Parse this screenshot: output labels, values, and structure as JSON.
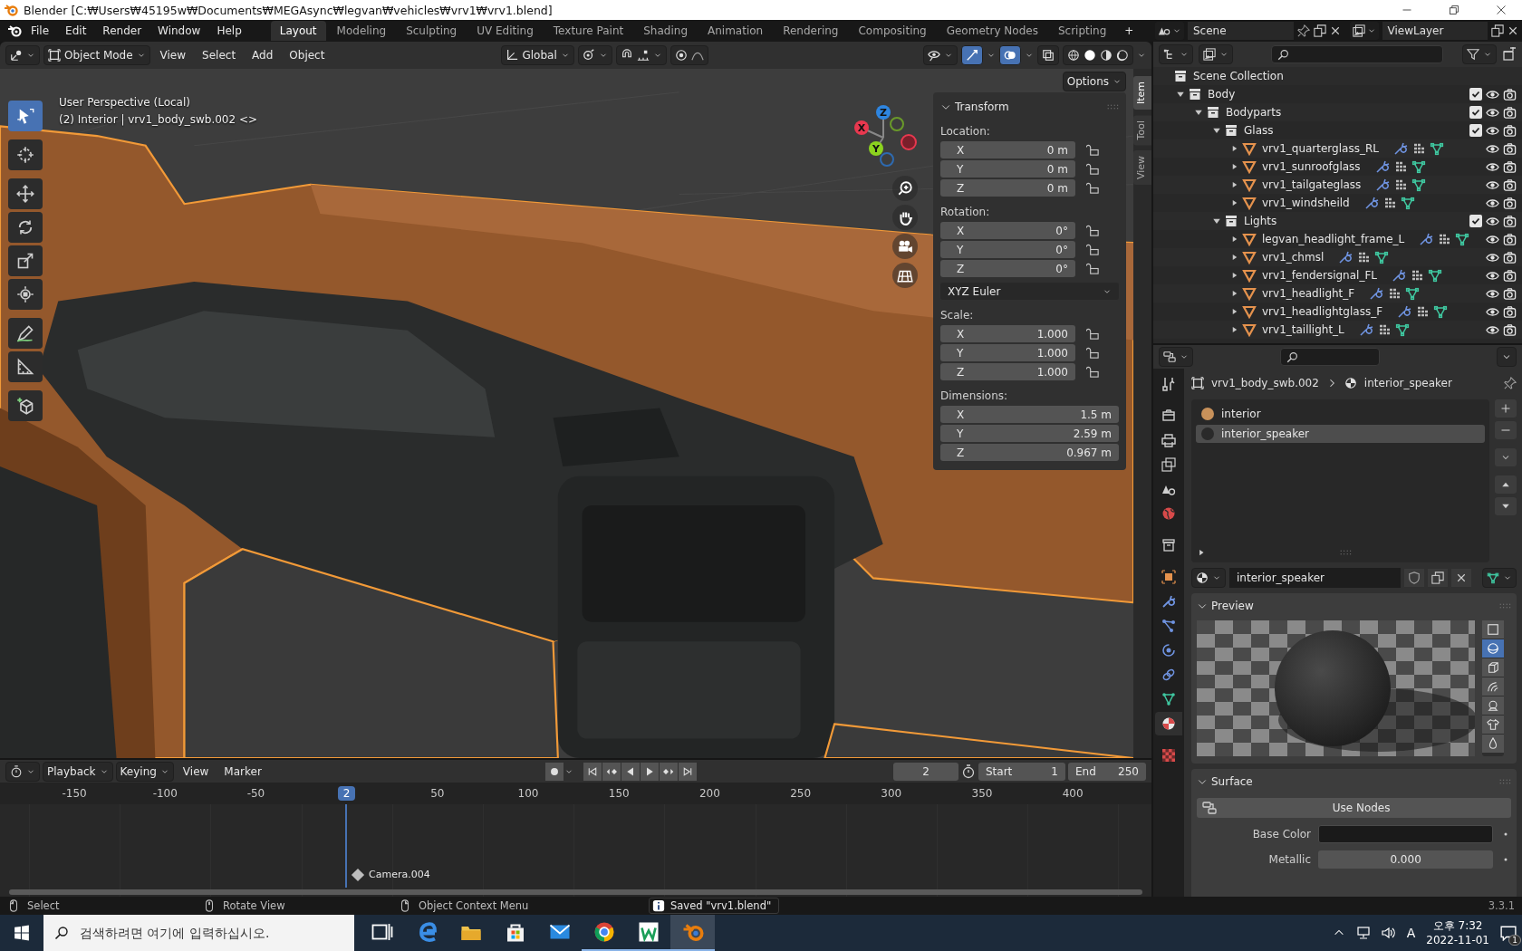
{
  "title_bar": {
    "title": "Blender [C:₩Users₩45195w₩Documents₩MEGAsync₩legvan₩vehicles₩vrv1₩vrv1.blend]"
  },
  "menu_bar": {
    "menus": [
      "File",
      "Edit",
      "Render",
      "Window",
      "Help"
    ],
    "workspaces": [
      {
        "label": "Layout",
        "selected": true
      },
      {
        "label": "Modeling",
        "selected": false
      },
      {
        "label": "Sculpting",
        "selected": false
      },
      {
        "label": "UV Editing",
        "selected": false
      },
      {
        "label": "Texture Paint",
        "selected": false
      },
      {
        "label": "Shading",
        "selected": false
      },
      {
        "label": "Animation",
        "selected": false
      },
      {
        "label": "Rendering",
        "selected": false
      },
      {
        "label": "Compositing",
        "selected": false
      },
      {
        "label": "Geometry Nodes",
        "selected": false
      },
      {
        "label": "Scripting",
        "selected": false
      }
    ],
    "add_workspace": "+",
    "scene": "Scene",
    "view_layer": "ViewLayer"
  },
  "viewport": {
    "mode": "Object Mode",
    "menus": [
      "View",
      "Select",
      "Add",
      "Object"
    ],
    "orientation": "Global",
    "options": "Options",
    "info": [
      "User Perspective (Local)",
      "(2) Interior | vrv1_body_swb.002 <>"
    ],
    "tools": [
      {
        "kind": "select",
        "selected": true
      },
      {
        "kind": "cursor",
        "selected": false
      },
      {
        "kind": "move",
        "selected": false
      },
      {
        "kind": "rotate",
        "selected": false
      },
      {
        "kind": "scale",
        "selected": false
      },
      {
        "kind": "transform",
        "selected": false
      },
      {
        "kind": "annotate",
        "selected": false
      },
      {
        "kind": "measure",
        "selected": false
      },
      {
        "kind": "add_cube",
        "selected": false
      }
    ],
    "gizmo": [
      {
        "label": "Z",
        "color": "#2e85e0"
      },
      {
        "label": "X",
        "color": "#e8384f"
      },
      {
        "label": "Y",
        "color": "#8cd31f"
      }
    ],
    "sidebar_tabs": [
      {
        "label": "Item",
        "selected": true
      },
      {
        "label": "Tool",
        "selected": false
      },
      {
        "label": "View",
        "selected": false
      }
    ],
    "transform": {
      "title": "Transform",
      "groups": [
        {
          "label": "Location:",
          "rows": [
            {
              "axis": "X",
              "value": "0 m",
              "locked": false
            },
            {
              "axis": "Y",
              "value": "0 m",
              "locked": false
            },
            {
              "axis": "Z",
              "value": "0 m",
              "locked": false
            }
          ]
        },
        {
          "label": "Rotation:",
          "rows": [
            {
              "axis": "X",
              "value": "0°",
              "locked": false
            },
            {
              "axis": "Y",
              "value": "0°",
              "locked": false
            },
            {
              "axis": "Z",
              "value": "0°",
              "locked": false
            }
          ],
          "mode": "XYZ Euler"
        },
        {
          "label": "Scale:",
          "rows": [
            {
              "axis": "X",
              "value": "1.000",
              "locked": false
            },
            {
              "axis": "Y",
              "value": "1.000",
              "locked": false
            },
            {
              "axis": "Z",
              "value": "1.000",
              "locked": false
            }
          ]
        },
        {
          "label": "Dimensions:",
          "rows": [
            {
              "axis": "X",
              "value": "1.5 m"
            },
            {
              "axis": "Y",
              "value": "2.59 m"
            },
            {
              "axis": "Z",
              "value": "0.967 m"
            }
          ]
        }
      ]
    }
  },
  "timeline": {
    "menus": [
      "Playback",
      "Keying",
      "View",
      "Marker"
    ],
    "current_frame": "2",
    "start_label": "Start",
    "start": "1",
    "end_label": "End",
    "end": "250",
    "ticks_before": [
      "-150",
      "-100",
      "-50"
    ],
    "playhead": "2",
    "ticks_after": [
      "50",
      "100",
      "150",
      "200",
      "250",
      "300",
      "350",
      "400"
    ],
    "marker": "Camera.004"
  },
  "status_bar": {
    "hints": [
      "Select",
      "Rotate View",
      "Object Context Menu"
    ],
    "report": "Saved \"vrv1.blend\"",
    "version": "3.3.1"
  },
  "outliner": {
    "root": "Scene Collection",
    "children": [
      {
        "name": "Body",
        "kind": "collection",
        "expanded": true,
        "checked": true,
        "children": [
          {
            "name": "Bodyparts",
            "kind": "collection",
            "expanded": true,
            "checked": true,
            "children": [
              {
                "name": "Glass",
                "kind": "collection",
                "expanded": true,
                "checked": true,
                "children": [
                  {
                    "name": "vrv1_quarterglass_RL",
                    "kind": "object",
                    "expanded": false
                  },
                  {
                    "name": "vrv1_sunroofglass",
                    "kind": "object",
                    "expanded": false
                  },
                  {
                    "name": "vrv1_tailgateglass",
                    "kind": "object",
                    "expanded": false
                  },
                  {
                    "name": "vrv1_windsheild",
                    "kind": "object",
                    "expanded": false
                  }
                ]
              },
              {
                "name": "Lights",
                "kind": "collection",
                "expanded": true,
                "checked": true,
                "children": [
                  {
                    "name": "legvan_headlight_frame_L",
                    "kind": "object",
                    "expanded": false
                  },
                  {
                    "name": "vrv1_chmsl",
                    "kind": "object",
                    "expanded": false
                  },
                  {
                    "name": "vrv1_fendersignal_FL",
                    "kind": "object",
                    "expanded": false
                  },
                  {
                    "name": "vrv1_headlight_F",
                    "kind": "object",
                    "expanded": false
                  },
                  {
                    "name": "vrv1_headlightglass_F",
                    "kind": "object",
                    "expanded": false
                  },
                  {
                    "name": "vrv1_taillight_L",
                    "kind": "object",
                    "expanded": false
                  }
                ]
              }
            ]
          }
        ]
      }
    ]
  },
  "properties": {
    "tabs": [
      {
        "kind": "tool",
        "selected": false
      },
      {
        "kind": "render",
        "selected": false
      },
      {
        "kind": "output",
        "selected": false
      },
      {
        "kind": "view_layer",
        "selected": false
      },
      {
        "kind": "scene",
        "selected": false
      },
      {
        "kind": "world",
        "selected": false
      },
      {
        "kind": "collection",
        "selected": false
      },
      {
        "kind": "object",
        "selected": false
      },
      {
        "kind": "modifiers",
        "selected": false
      },
      {
        "kind": "particles",
        "selected": false
      },
      {
        "kind": "physics",
        "selected": false
      },
      {
        "kind": "constraints",
        "selected": false
      },
      {
        "kind": "data",
        "selected": false
      },
      {
        "kind": "material",
        "selected": true
      },
      {
        "kind": "texture",
        "selected": false
      }
    ],
    "object": "vrv1_body_swb.002",
    "material": "interior_speaker",
    "slots": [
      {
        "name": "interior",
        "color": "#c8915a",
        "selected": false
      },
      {
        "name": "interior_speaker",
        "color": "#2a2a2a",
        "selected": true
      }
    ],
    "material_name": "interior_speaker",
    "preview": {
      "title": "Preview",
      "shapes": [
        {
          "kind": "plane",
          "selected": false
        },
        {
          "kind": "sphere",
          "selected": true
        },
        {
          "kind": "cube",
          "selected": false
        },
        {
          "kind": "hair",
          "selected": false
        },
        {
          "kind": "monkey",
          "selected": false
        },
        {
          "kind": "cloth",
          "selected": false
        },
        {
          "kind": "fluid",
          "selected": false
        }
      ]
    },
    "surface": {
      "title": "Surface",
      "use_nodes": "Use Nodes",
      "fields": [
        {
          "kind": "color",
          "label": "Base Color"
        },
        {
          "kind": "number",
          "label": "Metallic",
          "value": "0.000"
        }
      ]
    }
  },
  "taskbar": {
    "search_placeholder": "검색하려면 여기에 입력하십시오.",
    "apps": [
      {
        "kind": "task_view",
        "running": false,
        "selected": false
      },
      {
        "kind": "edge",
        "running": false,
        "selected": false
      },
      {
        "kind": "explorer",
        "running": false,
        "selected": false
      },
      {
        "kind": "store",
        "running": false,
        "selected": false
      },
      {
        "kind": "mail",
        "running": false,
        "selected": false
      },
      {
        "kind": "chrome",
        "running": true,
        "selected": false
      },
      {
        "kind": "green_app",
        "running": true,
        "selected": false
      },
      {
        "kind": "blender",
        "running": true,
        "selected": true
      }
    ],
    "ime": "A",
    "time": "오후 7:32",
    "date": "2022-11-01",
    "notifications": "1"
  }
}
